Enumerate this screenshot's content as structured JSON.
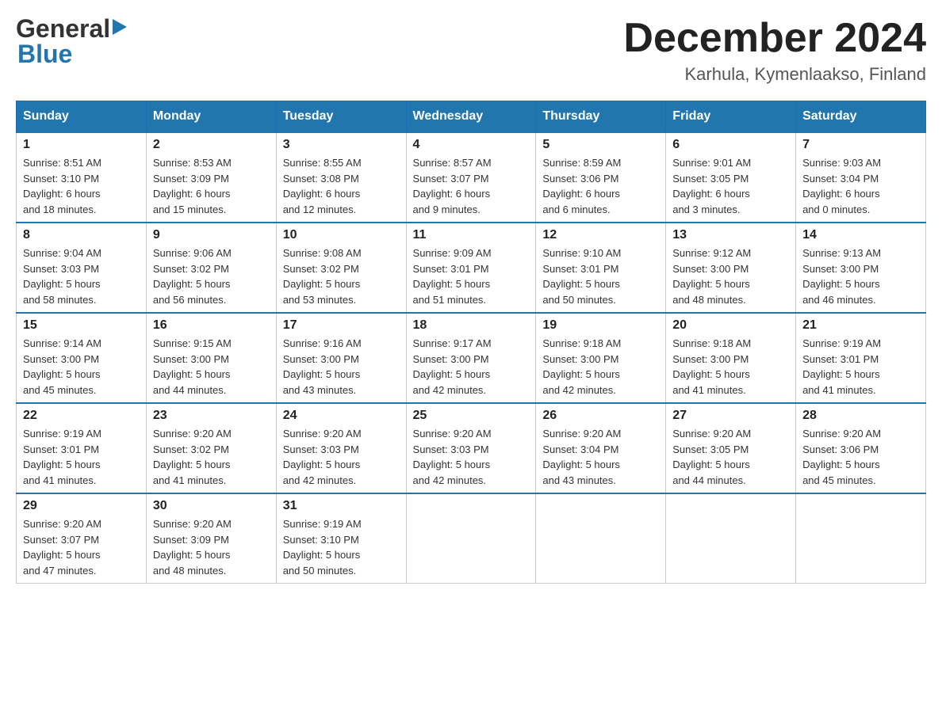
{
  "header": {
    "logo_general": "General",
    "logo_blue": "Blue",
    "month": "December 2024",
    "location": "Karhula, Kymenlaakso, Finland"
  },
  "weekdays": [
    "Sunday",
    "Monday",
    "Tuesday",
    "Wednesday",
    "Thursday",
    "Friday",
    "Saturday"
  ],
  "weeks": [
    [
      {
        "day": "1",
        "info": "Sunrise: 8:51 AM\nSunset: 3:10 PM\nDaylight: 6 hours\nand 18 minutes."
      },
      {
        "day": "2",
        "info": "Sunrise: 8:53 AM\nSunset: 3:09 PM\nDaylight: 6 hours\nand 15 minutes."
      },
      {
        "day": "3",
        "info": "Sunrise: 8:55 AM\nSunset: 3:08 PM\nDaylight: 6 hours\nand 12 minutes."
      },
      {
        "day": "4",
        "info": "Sunrise: 8:57 AM\nSunset: 3:07 PM\nDaylight: 6 hours\nand 9 minutes."
      },
      {
        "day": "5",
        "info": "Sunrise: 8:59 AM\nSunset: 3:06 PM\nDaylight: 6 hours\nand 6 minutes."
      },
      {
        "day": "6",
        "info": "Sunrise: 9:01 AM\nSunset: 3:05 PM\nDaylight: 6 hours\nand 3 minutes."
      },
      {
        "day": "7",
        "info": "Sunrise: 9:03 AM\nSunset: 3:04 PM\nDaylight: 6 hours\nand 0 minutes."
      }
    ],
    [
      {
        "day": "8",
        "info": "Sunrise: 9:04 AM\nSunset: 3:03 PM\nDaylight: 5 hours\nand 58 minutes."
      },
      {
        "day": "9",
        "info": "Sunrise: 9:06 AM\nSunset: 3:02 PM\nDaylight: 5 hours\nand 56 minutes."
      },
      {
        "day": "10",
        "info": "Sunrise: 9:08 AM\nSunset: 3:02 PM\nDaylight: 5 hours\nand 53 minutes."
      },
      {
        "day": "11",
        "info": "Sunrise: 9:09 AM\nSunset: 3:01 PM\nDaylight: 5 hours\nand 51 minutes."
      },
      {
        "day": "12",
        "info": "Sunrise: 9:10 AM\nSunset: 3:01 PM\nDaylight: 5 hours\nand 50 minutes."
      },
      {
        "day": "13",
        "info": "Sunrise: 9:12 AM\nSunset: 3:00 PM\nDaylight: 5 hours\nand 48 minutes."
      },
      {
        "day": "14",
        "info": "Sunrise: 9:13 AM\nSunset: 3:00 PM\nDaylight: 5 hours\nand 46 minutes."
      }
    ],
    [
      {
        "day": "15",
        "info": "Sunrise: 9:14 AM\nSunset: 3:00 PM\nDaylight: 5 hours\nand 45 minutes."
      },
      {
        "day": "16",
        "info": "Sunrise: 9:15 AM\nSunset: 3:00 PM\nDaylight: 5 hours\nand 44 minutes."
      },
      {
        "day": "17",
        "info": "Sunrise: 9:16 AM\nSunset: 3:00 PM\nDaylight: 5 hours\nand 43 minutes."
      },
      {
        "day": "18",
        "info": "Sunrise: 9:17 AM\nSunset: 3:00 PM\nDaylight: 5 hours\nand 42 minutes."
      },
      {
        "day": "19",
        "info": "Sunrise: 9:18 AM\nSunset: 3:00 PM\nDaylight: 5 hours\nand 42 minutes."
      },
      {
        "day": "20",
        "info": "Sunrise: 9:18 AM\nSunset: 3:00 PM\nDaylight: 5 hours\nand 41 minutes."
      },
      {
        "day": "21",
        "info": "Sunrise: 9:19 AM\nSunset: 3:01 PM\nDaylight: 5 hours\nand 41 minutes."
      }
    ],
    [
      {
        "day": "22",
        "info": "Sunrise: 9:19 AM\nSunset: 3:01 PM\nDaylight: 5 hours\nand 41 minutes."
      },
      {
        "day": "23",
        "info": "Sunrise: 9:20 AM\nSunset: 3:02 PM\nDaylight: 5 hours\nand 41 minutes."
      },
      {
        "day": "24",
        "info": "Sunrise: 9:20 AM\nSunset: 3:03 PM\nDaylight: 5 hours\nand 42 minutes."
      },
      {
        "day": "25",
        "info": "Sunrise: 9:20 AM\nSunset: 3:03 PM\nDaylight: 5 hours\nand 42 minutes."
      },
      {
        "day": "26",
        "info": "Sunrise: 9:20 AM\nSunset: 3:04 PM\nDaylight: 5 hours\nand 43 minutes."
      },
      {
        "day": "27",
        "info": "Sunrise: 9:20 AM\nSunset: 3:05 PM\nDaylight: 5 hours\nand 44 minutes."
      },
      {
        "day": "28",
        "info": "Sunrise: 9:20 AM\nSunset: 3:06 PM\nDaylight: 5 hours\nand 45 minutes."
      }
    ],
    [
      {
        "day": "29",
        "info": "Sunrise: 9:20 AM\nSunset: 3:07 PM\nDaylight: 5 hours\nand 47 minutes."
      },
      {
        "day": "30",
        "info": "Sunrise: 9:20 AM\nSunset: 3:09 PM\nDaylight: 5 hours\nand 48 minutes."
      },
      {
        "day": "31",
        "info": "Sunrise: 9:19 AM\nSunset: 3:10 PM\nDaylight: 5 hours\nand 50 minutes."
      },
      {
        "day": "",
        "info": ""
      },
      {
        "day": "",
        "info": ""
      },
      {
        "day": "",
        "info": ""
      },
      {
        "day": "",
        "info": ""
      }
    ]
  ]
}
